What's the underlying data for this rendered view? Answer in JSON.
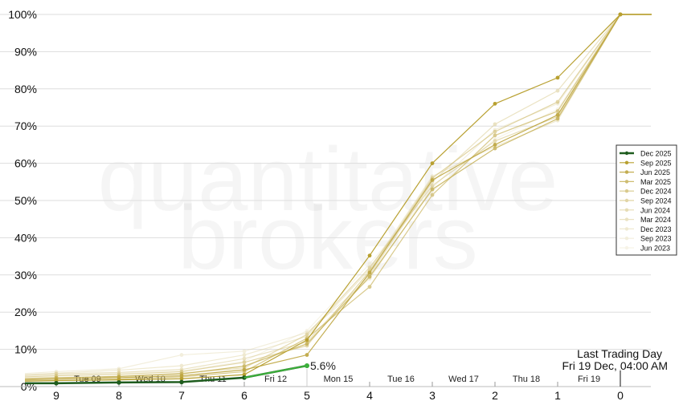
{
  "chart_data": {
    "type": "line",
    "watermark": [
      "quantitative",
      "brokers"
    ],
    "x": [
      9,
      8,
      7,
      6,
      5,
      4,
      3,
      2,
      1,
      0
    ],
    "x_ticks": [
      "9",
      "8",
      "7",
      "6",
      "5",
      "4",
      "3",
      "2",
      "1",
      "0"
    ],
    "day_labels": [
      {
        "label": "Tue 09",
        "x": 8.5
      },
      {
        "label": "Wed 10",
        "x": 7.5
      },
      {
        "label": "Thu 11",
        "x": 6.5
      },
      {
        "label": "Fri 12",
        "x": 5.5
      },
      {
        "label": "Mon 15",
        "x": 4.5
      },
      {
        "label": "Tue 16",
        "x": 3.5
      },
      {
        "label": "Wed 17",
        "x": 2.5
      },
      {
        "label": "Thu 18",
        "x": 1.5
      },
      {
        "label": "Fri 19",
        "x": 0.5
      }
    ],
    "xlim": [
      9.5,
      -0.5
    ],
    "ylim": [
      0,
      100
    ],
    "y_ticks": [
      "0%",
      "10%",
      "20%",
      "30%",
      "40%",
      "50%",
      "60%",
      "70%",
      "80%",
      "90%",
      "100%"
    ],
    "grid": true,
    "legend_position": "right",
    "annotation": {
      "label": "5.6%",
      "x": 5,
      "y": 5.6
    },
    "last_trading_day": {
      "title": "Last Trading Day",
      "date": "Fri 19 Dec, 04:00 AM",
      "x": 0
    },
    "series": [
      {
        "name": "Dec 2025",
        "color": "#1e5c1e",
        "width": 2.5,
        "opacity": 1.0,
        "x": [
          9.5,
          9,
          8,
          7,
          6,
          5
        ],
        "values": [
          0.9,
          0.9,
          1.1,
          1.2,
          2.4,
          5.6
        ]
      },
      {
        "name": "Sep 2025",
        "color": "#b8a030",
        "width": 1.2,
        "opacity": 1.0,
        "x": [
          9.5,
          9,
          8,
          7,
          6,
          5,
          4,
          3,
          2,
          1,
          0,
          -0.5
        ],
        "values": [
          1.5,
          1.6,
          1.8,
          2.1,
          3.2,
          12.5,
          35.2,
          60.0,
          76.0,
          83.0,
          100,
          100
        ]
      },
      {
        "name": "Jun 2025",
        "color": "#bda53e",
        "width": 1.2,
        "opacity": 0.9,
        "x": [
          9.5,
          9,
          8,
          7,
          6,
          5,
          4,
          3,
          2,
          1,
          0,
          -0.5
        ],
        "values": [
          1.8,
          2.0,
          2.4,
          2.9,
          4.5,
          8.5,
          30.6,
          55.5,
          65.0,
          73.0,
          100,
          100
        ]
      },
      {
        "name": "Mar 2025",
        "color": "#c3ad4e",
        "width": 1.2,
        "opacity": 0.8,
        "x": [
          9.5,
          9,
          8,
          7,
          6,
          5,
          4,
          3,
          2,
          1,
          0,
          -0.5
        ],
        "values": [
          2.2,
          2.4,
          2.7,
          3.4,
          5.5,
          11.5,
          29.5,
          53.0,
          64.0,
          72.0,
          100,
          100
        ]
      },
      {
        "name": "Dec 2024",
        "color": "#c9b45d",
        "width": 1.2,
        "opacity": 0.7,
        "x": [
          9.5,
          9,
          8,
          7,
          6,
          5,
          4,
          3,
          2,
          1,
          0,
          -0.5
        ],
        "values": [
          1.4,
          1.6,
          2.0,
          2.6,
          4.0,
          13.0,
          26.8,
          51.5,
          67.5,
          74.0,
          100,
          100
        ]
      },
      {
        "name": "Sep 2024",
        "color": "#ceba6a",
        "width": 1.2,
        "opacity": 0.6,
        "x": [
          9.5,
          9,
          8,
          7,
          6,
          5,
          4,
          3,
          2,
          1,
          0,
          -0.5
        ],
        "values": [
          2.6,
          2.9,
          3.3,
          4.0,
          6.5,
          11.0,
          31.0,
          56.0,
          68.5,
          76.5,
          100,
          100
        ]
      },
      {
        "name": "Jun 2024",
        "color": "#d2c078",
        "width": 1.2,
        "opacity": 0.55,
        "x": [
          9.5,
          9,
          8,
          7,
          6,
          5,
          4,
          3,
          2,
          1,
          0,
          -0.5
        ],
        "values": [
          2.0,
          2.2,
          2.8,
          3.6,
          5.0,
          14.0,
          32.0,
          54.0,
          66.0,
          72.5,
          100,
          100
        ]
      },
      {
        "name": "Mar 2024",
        "color": "#d7c787",
        "width": 1.2,
        "opacity": 0.5,
        "x": [
          9.5,
          9,
          8,
          7,
          6,
          5,
          4,
          3,
          2,
          1,
          0,
          -0.5
        ],
        "values": [
          3.0,
          3.4,
          3.8,
          4.6,
          7.5,
          12.0,
          30.0,
          55.0,
          70.5,
          79.5,
          100,
          100
        ]
      },
      {
        "name": "Dec 2023",
        "color": "#dccf98",
        "width": 1.2,
        "opacity": 0.45,
        "x": [
          9.5,
          9,
          8,
          7,
          6,
          5,
          4,
          3,
          2,
          1,
          0,
          -0.5
        ],
        "values": [
          3.2,
          3.6,
          4.4,
          5.6,
          8.5,
          13.5,
          31.5,
          56.5,
          64.5,
          71.5,
          100,
          100
        ]
      },
      {
        "name": "Sep 2023",
        "color": "#e1d6aa",
        "width": 1.2,
        "opacity": 0.4,
        "x": [
          9.5,
          9,
          8,
          7,
          6,
          5,
          4,
          3,
          2,
          1,
          0,
          -0.5
        ],
        "values": [
          3.5,
          4.0,
          4.8,
          8.5,
          9.5,
          14.5,
          29.0,
          53.5,
          69.0,
          76.0,
          100,
          100
        ]
      },
      {
        "name": "Jun 2023",
        "color": "#e7dfbd",
        "width": 1.2,
        "opacity": 0.35,
        "x": [
          9.5,
          9,
          8,
          7,
          6,
          5,
          4,
          3,
          2,
          1,
          0,
          -0.5
        ],
        "values": [
          2.8,
          3.1,
          3.6,
          4.2,
          6.8,
          15.0,
          33.0,
          52.5,
          66.5,
          74.5,
          100,
          100
        ]
      }
    ]
  }
}
